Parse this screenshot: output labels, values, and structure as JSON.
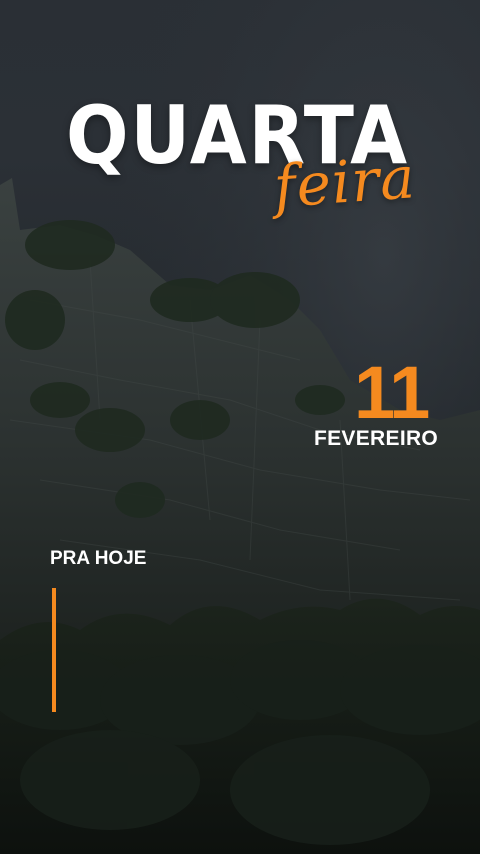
{
  "title": {
    "weekday": "QUARTA",
    "suffix": "feira"
  },
  "date": {
    "day": "11",
    "month": "FEVEREIRO"
  },
  "section": {
    "label": "PRA HOJE"
  },
  "colors": {
    "accent": "#f58a1f",
    "text": "#ffffff",
    "sky": "#2b3036",
    "foliage": "#151a17"
  },
  "background": {
    "icon": "mountain-cliff-photo"
  }
}
